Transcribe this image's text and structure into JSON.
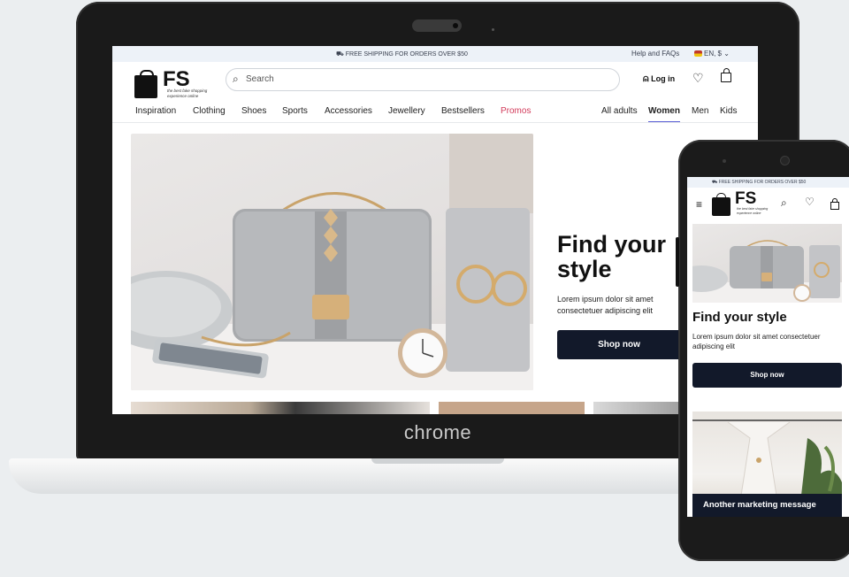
{
  "laptop": {
    "brand": "chrome",
    "page": {
      "topbar": {
        "shipping": "FREE SHIPPING FOR ORDERS OVER $50",
        "help": "Help and FAQs",
        "language": "EN, $"
      },
      "logo": {
        "text": "FS",
        "tagline_line1": "the best fake shopping",
        "tagline_line2": "experience online"
      },
      "search": {
        "placeholder": "Search"
      },
      "actions": {
        "login": "Log in"
      },
      "nav": {
        "categories": [
          "Inspiration",
          "Clothing",
          "Shoes",
          "Sports",
          "Accessories",
          "Jewellery",
          "Bestsellers",
          "Promos"
        ],
        "audiences": [
          "All adults",
          "Women",
          "Men",
          "Kids"
        ],
        "active_audience": "Women"
      },
      "hero": {
        "title_line1": "Find your",
        "title_line2": "style",
        "subtitle": "Lorem ipsum dolor sit amet consectetuer adipiscing elit",
        "cta": "Shop now"
      }
    }
  },
  "phone": {
    "topbar": {
      "shipping": "FREE SHIPPING FOR ORDERS OVER $50"
    },
    "logo": {
      "text": "FS",
      "tagline_line1": "the best fake shopping",
      "tagline_line2": "experience online"
    },
    "hero": {
      "title": "Find your style",
      "subtitle": "Lorem ipsum dolor sit amet consectetuer adipiscing elit",
      "cta": "Shop now"
    },
    "banner": {
      "caption": "Another marketing message"
    }
  },
  "colors": {
    "accent": "#5b5fd6",
    "promo": "#d23a5a",
    "button": "#12192a",
    "topbar": "#edf2f8"
  },
  "icons": [
    "truck-icon",
    "flag-icon",
    "chevron-down-icon",
    "search-icon",
    "user-icon",
    "heart-icon",
    "bag-icon",
    "menu-icon"
  ]
}
